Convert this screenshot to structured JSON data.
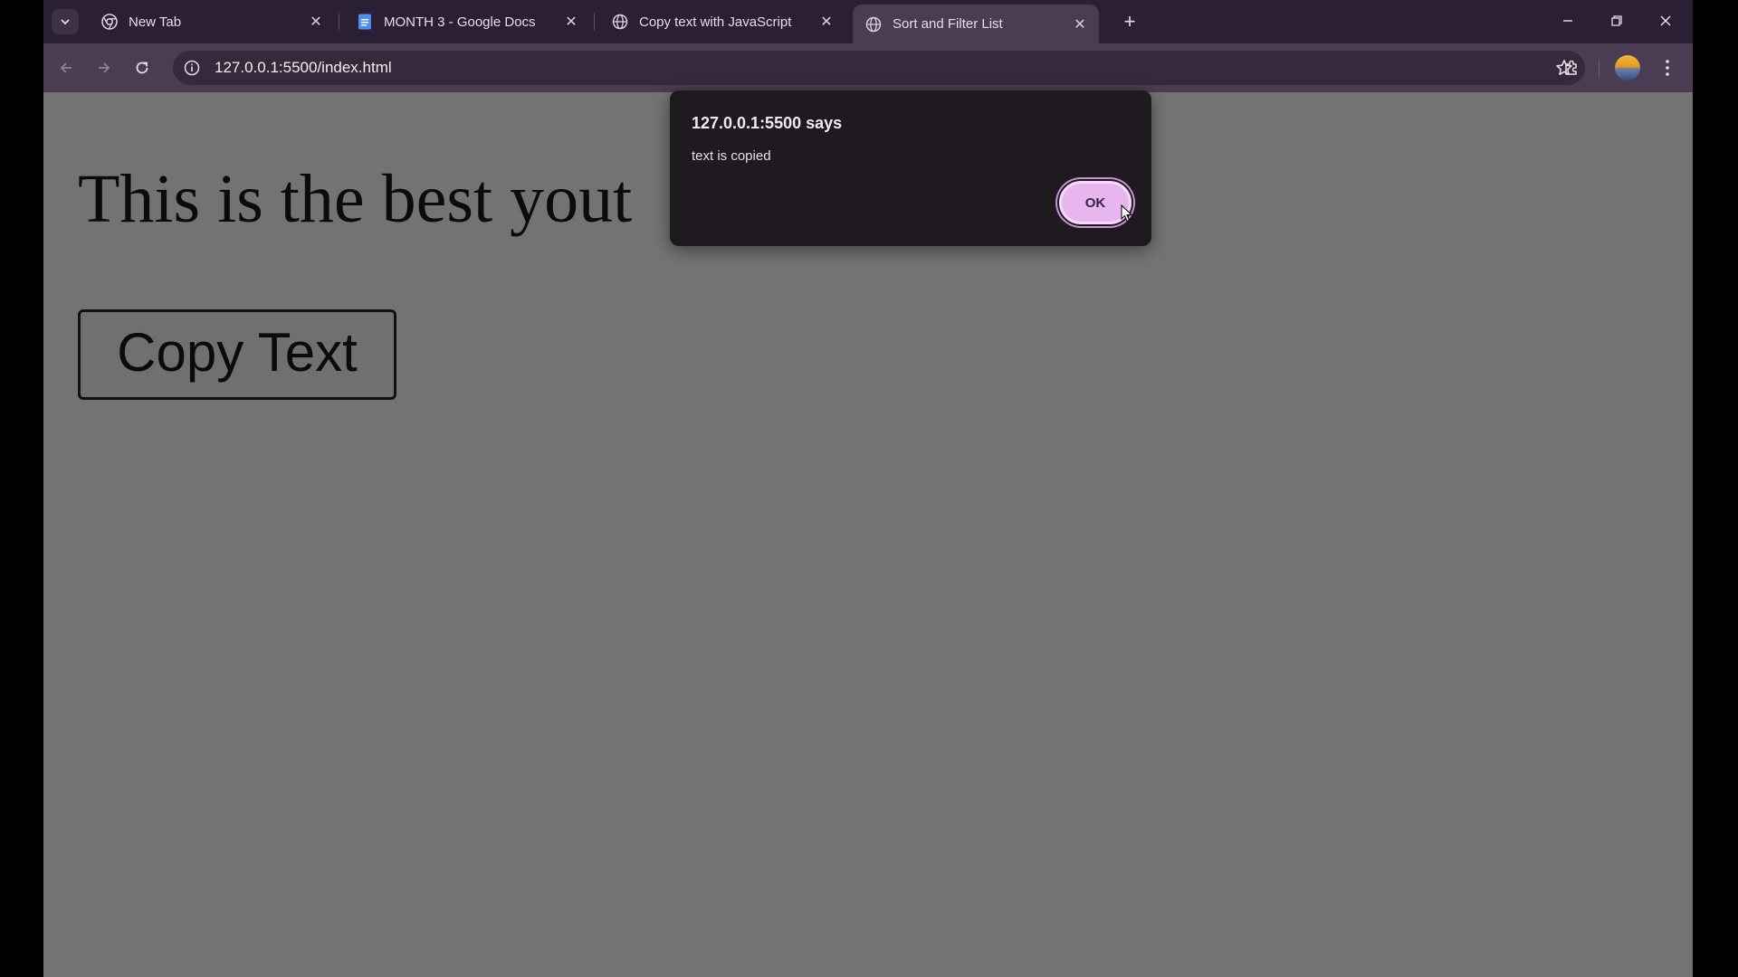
{
  "browser": {
    "tabs": [
      {
        "title": "New Tab",
        "icon": "chrome-icon",
        "active": false
      },
      {
        "title": "MONTH 3 - Google Docs",
        "icon": "google-docs-icon",
        "active": false
      },
      {
        "title": "Copy text with JavaScript",
        "icon": "globe-icon",
        "active": false
      },
      {
        "title": "Sort and Filter List",
        "icon": "globe-icon",
        "active": true
      }
    ],
    "close_glyph": "✕",
    "new_tab_glyph": "+",
    "address": {
      "url": "127.0.0.1:5500/index.html"
    }
  },
  "page": {
    "heading": "This is the best yout",
    "copy_button_label": "Copy Text"
  },
  "dialog": {
    "title": "127.0.0.1:5500 says",
    "message": "text is copied",
    "ok_label": "OK"
  },
  "colors": {
    "tabstrip": "#2b1f33",
    "toolbar": "#4a3c52",
    "page_background": "#737373",
    "dialog_background": "#1e1a20",
    "ok_button": "#e7b6ef"
  }
}
